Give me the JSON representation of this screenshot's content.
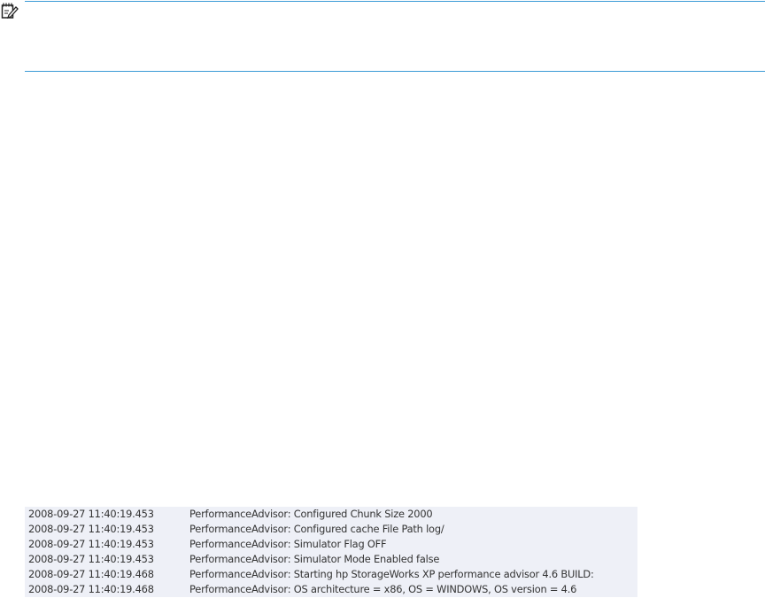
{
  "note": {
    "icon": "note-pad-icon"
  },
  "log": {
    "rows": [
      {
        "timestamp": "2008-09-27 11:40:19.453",
        "message": "PerformanceAdvisor: Configured Chunk Size 2000"
      },
      {
        "timestamp": "2008-09-27 11:40:19.453",
        "message": "PerformanceAdvisor: Configured cache File Path log/"
      },
      {
        "timestamp": "2008-09-27 11:40:19.453",
        "message": "PerformanceAdvisor: Simulator Flag OFF"
      },
      {
        "timestamp": "2008-09-27 11:40:19.453",
        "message": "PerformanceAdvisor: Simulator Mode Enabled false"
      },
      {
        "timestamp": "2008-09-27 11:40:19.468",
        "message": "PerformanceAdvisor: Starting hp StorageWorks XP performance advisor 4.6 BUILD:"
      },
      {
        "timestamp": "2008-09-27 11:40:19.468",
        "message": "PerformanceAdvisor: OS architecture = x86, OS = WINDOWS, OS version = 4.6"
      }
    ]
  }
}
